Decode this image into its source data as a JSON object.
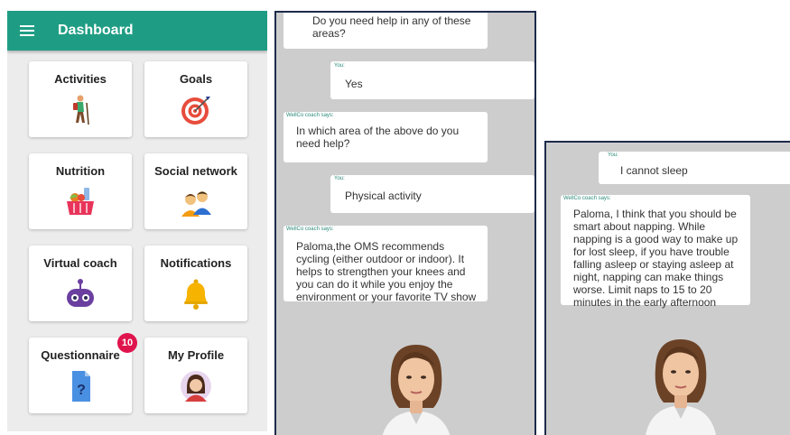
{
  "dashboard": {
    "title": "Dashboard",
    "tiles": [
      {
        "label": "Activities",
        "icon": "hiker-icon"
      },
      {
        "label": "Goals",
        "icon": "target-icon"
      },
      {
        "label": "Nutrition",
        "icon": "food-basket-icon"
      },
      {
        "label": "Social network",
        "icon": "people-icon"
      },
      {
        "label": "Virtual coach",
        "icon": "robot-icon"
      },
      {
        "label": "Notifications",
        "icon": "bell-icon"
      },
      {
        "label": "Questionnaire",
        "icon": "document-question-icon",
        "badge": "10"
      },
      {
        "label": "My Profile",
        "icon": "profile-avatar-icon"
      }
    ],
    "colors": {
      "appbar": "#1f9d84",
      "badge": "#e0144c"
    }
  },
  "chat1": {
    "messages": [
      {
        "sender": "",
        "text": "Do you need help in any of these areas?"
      },
      {
        "sender": "You:",
        "text": "Yes"
      },
      {
        "sender": "WellCo coach says:",
        "text": "In which area of the above do you need help?"
      },
      {
        "sender": "You:",
        "text": "Physical activity"
      },
      {
        "sender": "WellCo coach says:",
        "text": "Paloma,the OMS recommends cycling (either outdoor or indoor). It helps to strengthen your knees and you can do it while you enjoy the environment or your favorite TV show"
      }
    ]
  },
  "chat2": {
    "messages": [
      {
        "sender": "You:",
        "text": "I cannot sleep"
      },
      {
        "sender": "WellCo coach says:",
        "text": "Paloma, I think that you should be smart about napping. While napping is a good way to make up for lost sleep, if you have trouble falling asleep or staying asleep at night, napping can make things worse. Limit naps to 15 to 20 minutes in the early afternoon"
      }
    ]
  }
}
